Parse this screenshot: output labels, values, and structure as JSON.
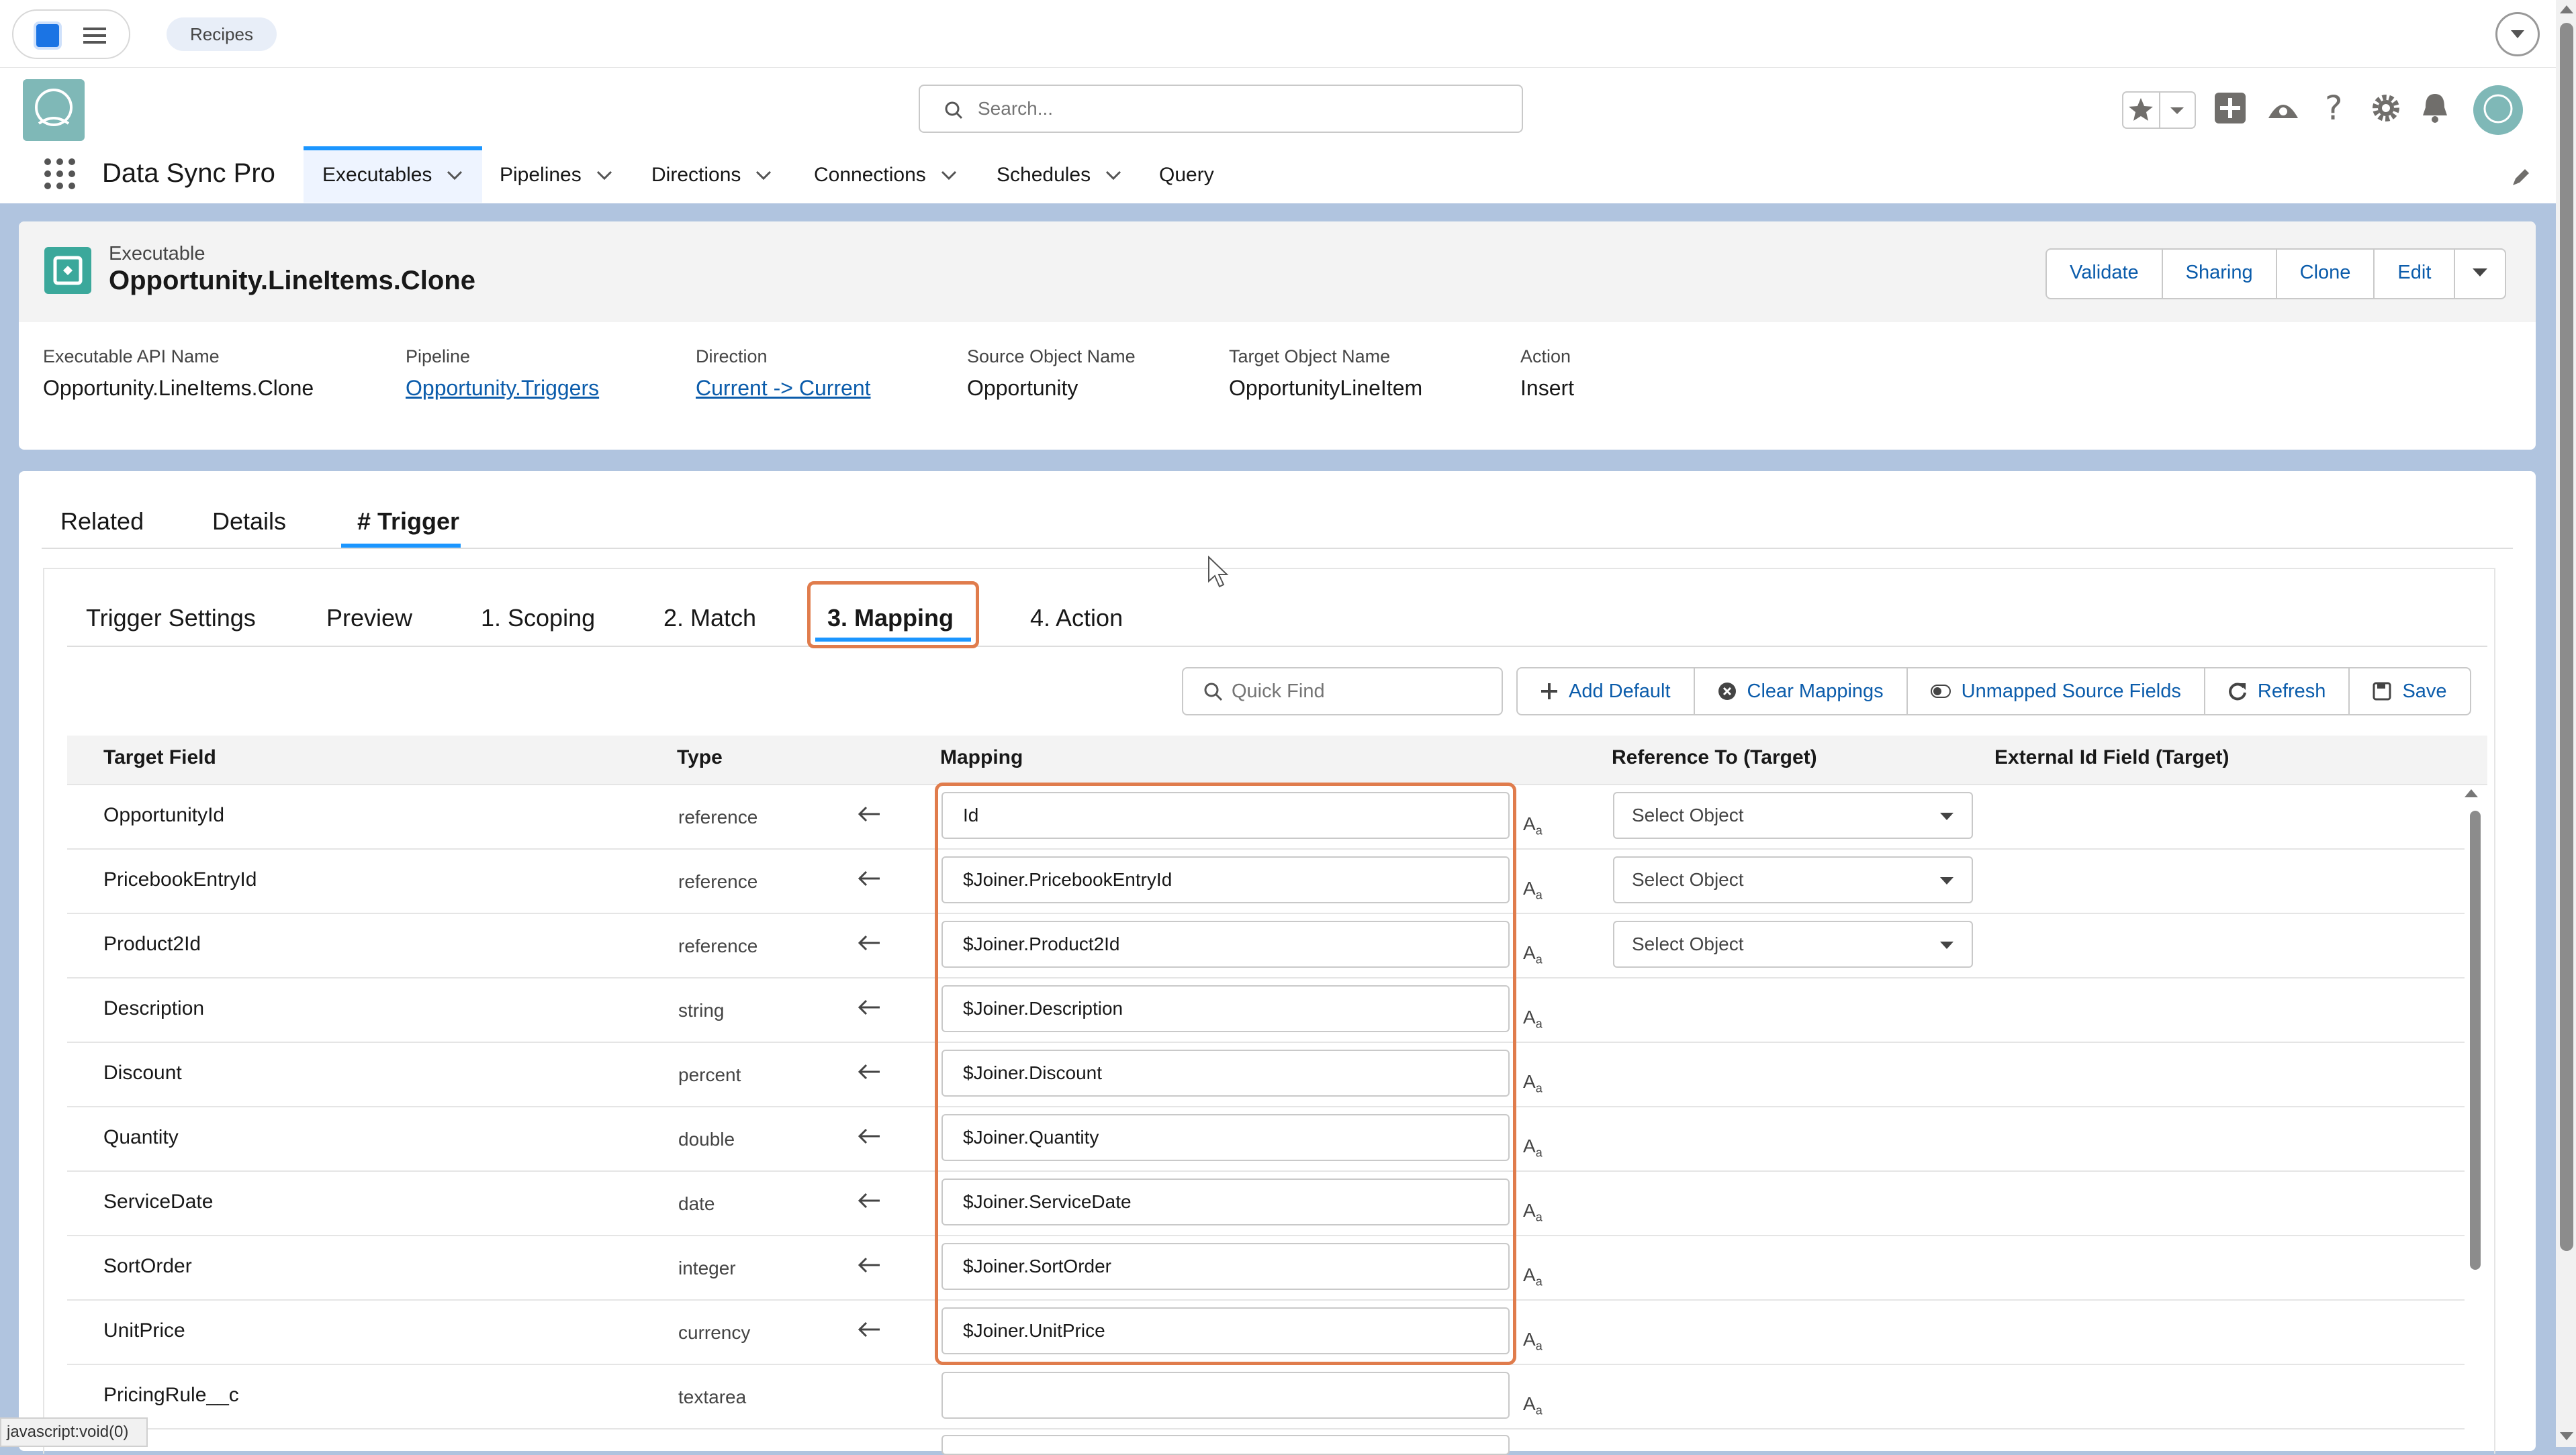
{
  "topbar": {
    "recipes_tab": "Recipes"
  },
  "header": {
    "search_placeholder": "Search...",
    "app_name": "Data Sync Pro",
    "nav": [
      "Executables",
      "Pipelines",
      "Directions",
      "Connections",
      "Schedules",
      "Query"
    ]
  },
  "record": {
    "type_label": "Executable",
    "title": "Opportunity.LineItems.Clone",
    "buttons": [
      "Validate",
      "Sharing",
      "Clone",
      "Edit"
    ],
    "fields": [
      {
        "label": "Executable API Name",
        "value": "Opportunity.LineItems.Clone"
      },
      {
        "label": "Pipeline",
        "value": "Opportunity.Triggers"
      },
      {
        "label": "Direction",
        "value": "Current -> Current"
      },
      {
        "label": "Source Object Name",
        "value": "Opportunity"
      },
      {
        "label": "Target Object Name",
        "value": "OpportunityLineItem"
      },
      {
        "label": "Action",
        "value": "Insert"
      }
    ]
  },
  "tabs": [
    "Related",
    "Details",
    "# Trigger"
  ],
  "subtabs": [
    "Trigger Settings",
    "Preview",
    "1. Scoping",
    "2. Match",
    "3. Mapping",
    "4. Action"
  ],
  "toolbar": {
    "quick_find_placeholder": "Quick Find",
    "buttons": [
      "Add Default",
      "Clear Mappings",
      "Unmapped Source Fields",
      "Refresh",
      "Save"
    ]
  },
  "table": {
    "headers": [
      "Target Field",
      "Type",
      "Mapping",
      "Reference To (Target)",
      "External Id Field (Target)"
    ],
    "select_placeholder": "Select Object",
    "aa_label": "A",
    "aa_sub": "a",
    "rows": [
      {
        "field": "OpportunityId",
        "type": "reference",
        "mapping": "Id"
      },
      {
        "field": "PricebookEntryId",
        "type": "reference",
        "mapping": "$Joiner.PricebookEntryId"
      },
      {
        "field": "Product2Id",
        "type": "reference",
        "mapping": "$Joiner.Product2Id"
      },
      {
        "field": "Description",
        "type": "string",
        "mapping": "$Joiner.Description"
      },
      {
        "field": "Discount",
        "type": "percent",
        "mapping": "$Joiner.Discount"
      },
      {
        "field": "Quantity",
        "type": "double",
        "mapping": "$Joiner.Quantity"
      },
      {
        "field": "ServiceDate",
        "type": "date",
        "mapping": "$Joiner.ServiceDate"
      },
      {
        "field": "SortOrder",
        "type": "integer",
        "mapping": "$Joiner.SortOrder"
      },
      {
        "field": "UnitPrice",
        "type": "currency",
        "mapping": "$Joiner.UnitPrice"
      },
      {
        "field": "PricingRule__c",
        "type": "textarea",
        "mapping": ""
      }
    ]
  },
  "status_bar": "javascript:void(0)",
  "colors": {
    "accent": "#1b96ff",
    "link": "#0b5cab",
    "highlight": "#e07c4c"
  }
}
